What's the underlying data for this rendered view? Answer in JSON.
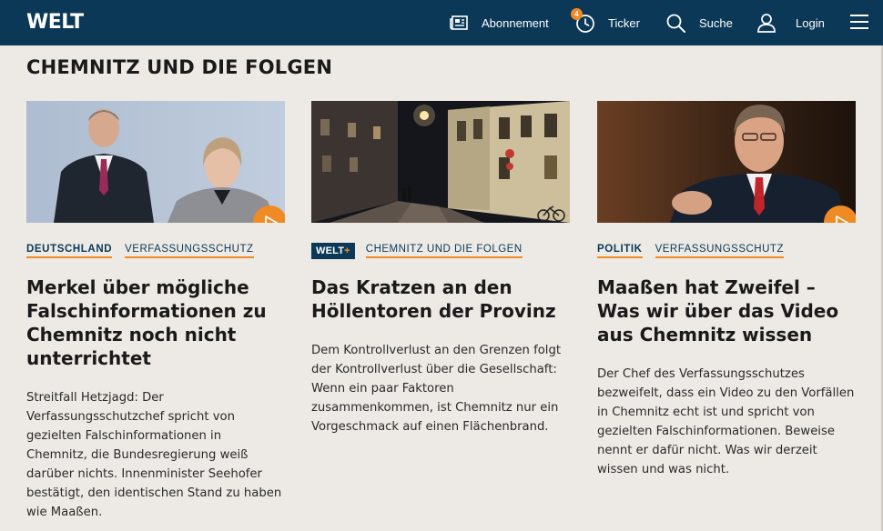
{
  "header": {
    "logo": "WELT",
    "nav": {
      "abonnement": "Abonnement",
      "ticker": "Ticker",
      "ticker_badge": "4",
      "suche": "Suche",
      "login": "Login"
    }
  },
  "section": {
    "title": "CHEMNITZ UND DIE FOLGEN"
  },
  "articles": [
    {
      "kicker": "DEUTSCHLAND",
      "topic": "VERFASSUNGSSCHUTZ",
      "headline": "Merkel über mögliche Falschinformationen zu Chemnitz noch nicht unterrichtet",
      "teaser": "Streitfall Hetzjagd: Der Verfassungsschutzchef spricht von gezielten Falschinformationen in Chemnitz, die Bundesregierung weiß darüber nichts. Innenminister Seehofer bestätigt, den identischen Stand zu haben wie Maaßen.",
      "has_video": true
    },
    {
      "badge": "WELT",
      "badge_plus": "+",
      "topic": "Chemnitz und die Folgen",
      "headline": "Das Kratzen an den Höllentoren der Provinz",
      "teaser": "Dem Kontrollverlust an den Grenzen folgt der Kontrollverlust über die Gesellschaft: Wenn ein paar Faktoren zusammenkommen, ist Chemnitz nur ein Vorgeschmack auf einen Flächenbrand.",
      "has_video": false
    },
    {
      "kicker": "POLITIK",
      "topic": "VERFASSUNGSSCHUTZ",
      "headline": "Maaßen hat Zweifel – Was wir über das Video aus Chemnitz wissen",
      "teaser": "Der Chef des Verfassungsschutzes bezweifelt, dass ein Video zu den Vorfällen in Chemnitz echt ist und spricht von gezielten Falschinformationen. Beweise nennt er dafür nicht. Was wir derzeit wissen und was nicht.",
      "has_video": true
    }
  ],
  "colors": {
    "header_bg": "#0a3856",
    "accent": "#f08a24",
    "page_bg": "#edeae6"
  }
}
